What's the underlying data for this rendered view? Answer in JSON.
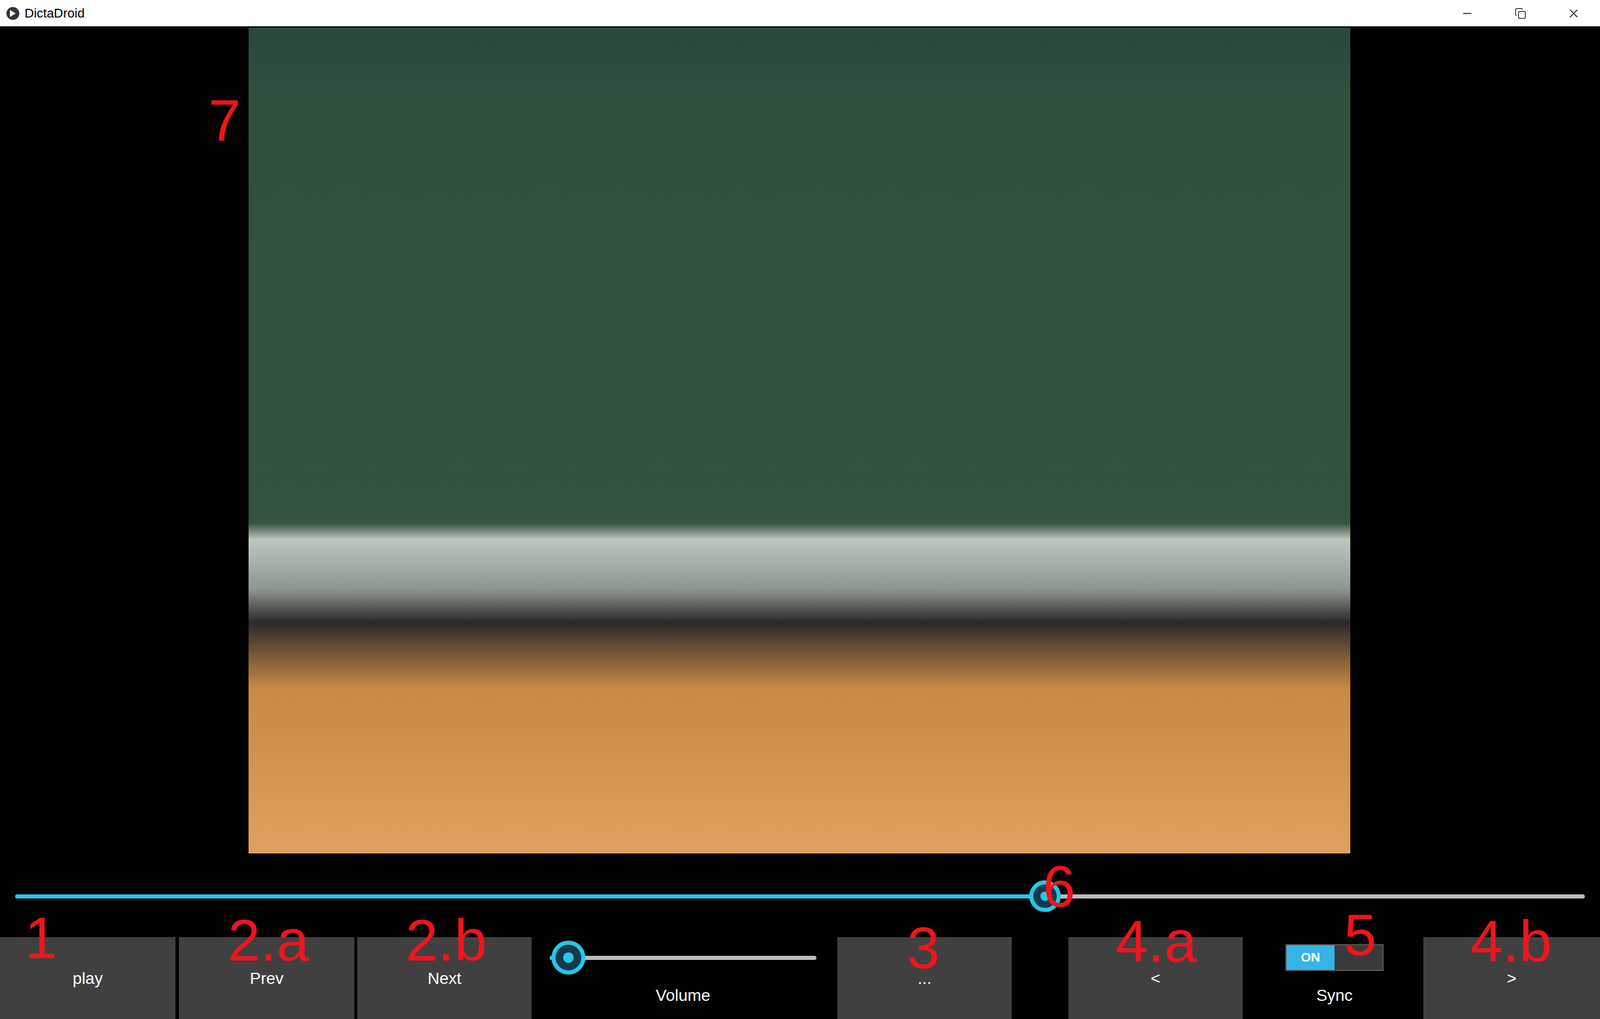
{
  "window": {
    "title": "DictaDroid"
  },
  "seek": {
    "level": 0.656
  },
  "toolbar": [
    {
      "kind": "button",
      "label": "play"
    },
    {
      "kind": "button",
      "label": "Prev"
    },
    {
      "kind": "button",
      "label": "Next"
    },
    {
      "kind": "slider",
      "label": "Volume",
      "level": 0.07
    },
    {
      "kind": "button",
      "label": "..."
    },
    {
      "kind": "button",
      "label": "<"
    },
    {
      "kind": "switch",
      "label": "Sync",
      "on": true,
      "state_text": "ON"
    },
    {
      "kind": "button",
      "label": ">"
    }
  ],
  "annotations": [
    "1",
    "2.a",
    "2.b",
    "3",
    "4.a",
    "5",
    "4.b",
    "6",
    "7"
  ]
}
